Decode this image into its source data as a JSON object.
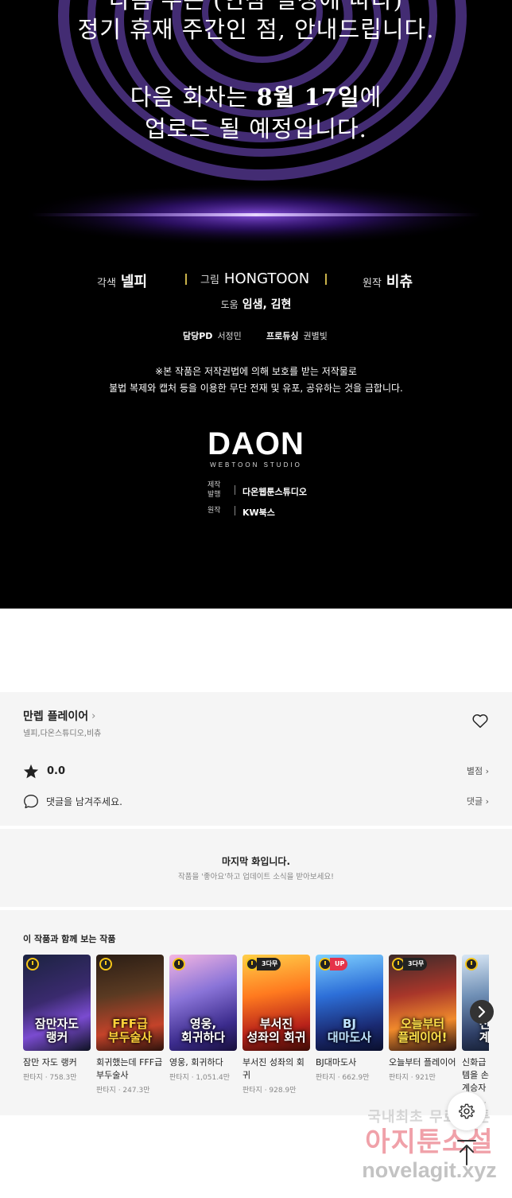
{
  "hero": {
    "notice_top": "다음 주는 (연참 일정에 따라)",
    "notice_mid": "정기 휴재 주간인 점, 안내드립니다.",
    "next_prefix": "다음 회차는 ",
    "next_date": "8월 17일",
    "next_suffix": "에",
    "next_line2": "업로드 될 예정입니다.",
    "credits": {
      "adapt_label": "각색",
      "adapt_value": "넬피",
      "art_label": "그림",
      "art_value": "HONGTOON",
      "original_label": "원작",
      "original_value": "비츄",
      "assist_label": "도움",
      "assist_value": "임샘, 김현"
    },
    "staff": {
      "pd_label": "담당PD",
      "pd_value": "서정민",
      "producing_label": "프로듀싱",
      "producing_value": "권별빛"
    },
    "copyright_line1": "※본 작품은 저작권법에 의해 보호를 받는 저작물로",
    "copyright_line2": "불법 복제와 캡처 등을 이용한 무단 전재 및 유포, 공유하는 것을 금합니다.",
    "logo_word": "DAON",
    "logo_sub": "WEBTOON STUDIO",
    "publisher_label": "제작\n발행",
    "publisher_value": "다온웹툰스튜디오",
    "source_label": "원작",
    "source_value": "KW북스"
  },
  "info": {
    "series_title": "만렙 플레이어",
    "authors": "넬피,다온스튜디오,비츄",
    "rating": "0.0",
    "rating_link": "별점",
    "comment_placeholder": "댓글을 남겨주세요.",
    "comment_link": "댓글"
  },
  "last_episode": {
    "title": "마지막 화입니다.",
    "subtitle": "작품을 '좋아요'하고 업데이트 소식을 받아보세요!"
  },
  "recommendations": {
    "heading": "이 작품과 함께 보는 작품",
    "items": [
      {
        "name": "잠만 자도 랭커",
        "meta": "판타지 · 758.3만",
        "badge": "",
        "cover": "잠만자도\n랭커"
      },
      {
        "name": "회귀했는데 FFF급 부두술사",
        "meta": "판타지 · 247.3만",
        "badge": "",
        "cover": "FFF급\n부두술사"
      },
      {
        "name": "영웅, 회귀하다",
        "meta": "판타지 · 1,051.4만",
        "badge": "",
        "cover": "영웅,\n회귀하다"
      },
      {
        "name": "부서진 성좌의 회귀",
        "meta": "판타지 · 928.9만",
        "badge": "3다무",
        "cover": "부서진\n성좌의 회귀"
      },
      {
        "name": "BJ대마도사",
        "meta": "판타지 · 662.9만",
        "badge": "UP",
        "cover": "BJ\n대마도사"
      },
      {
        "name": "오늘부터 플레이어",
        "meta": "판타지 · 921만",
        "badge": "3다무",
        "cover": "오늘부터\n플레이어!"
      },
      {
        "name": "신화급 귀속 아이템을 손에 넣었다 계승자",
        "meta": "판타지 · ",
        "badge": "",
        "cover": "신화급\n계승자"
      }
    ]
  },
  "watermark": {
    "line1": "국내최초 무료 웹툰",
    "line2": "아지툰소설",
    "line3": "novelagit.xyz"
  },
  "colors": {
    "hero_bg": "#000000",
    "accent_purple": "#7b3fe4",
    "credit_separator": "#c9b24a",
    "panel_bg": "#f5f5f5",
    "badge_up": "#e5334a"
  }
}
